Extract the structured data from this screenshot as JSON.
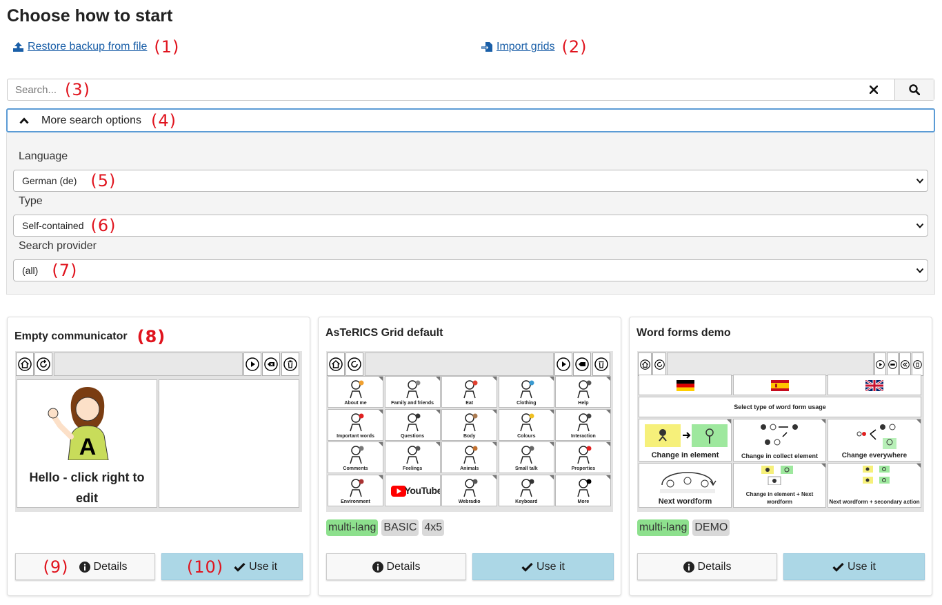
{
  "page": {
    "title": "Choose how to start"
  },
  "actions": {
    "restore_label": "Restore backup from file",
    "restore_marker": "(1)",
    "import_label": "Import grids",
    "import_marker": "(2)"
  },
  "search": {
    "placeholder": "Search...",
    "marker": "(3)"
  },
  "more_options": {
    "label": "More search options",
    "marker": "(4)"
  },
  "filters": {
    "language": {
      "label": "Language",
      "value": "German (de)",
      "marker": "(5)"
    },
    "type": {
      "label": "Type",
      "value": "Self-contained",
      "marker": "(6)"
    },
    "provider": {
      "label": "Search provider",
      "value": "(all)",
      "marker": "(7)"
    }
  },
  "cards": [
    {
      "title": "Empty communicator",
      "title_marker": "(8)",
      "preview_text": "Hello - click right to edit",
      "tags": [],
      "details_label": "Details",
      "details_marker": "(9)",
      "use_label": "Use it",
      "use_marker": "(10)"
    },
    {
      "title": "AsTeRICS Grid default",
      "cells": [
        "About me",
        "Family and friends",
        "Eat",
        "Clothing",
        "Help",
        "Important words",
        "Questions",
        "Body",
        "Colours",
        "Interaction",
        "Comments",
        "Feelings",
        "Animals",
        "Small talk",
        "Properties",
        "Environment",
        "YouTube",
        "Webradio",
        "Keyboard",
        "More"
      ],
      "tags": [
        "multi-lang",
        "BASIC",
        "4x5"
      ],
      "details_label": "Details",
      "use_label": "Use it"
    },
    {
      "title": "Word forms demo",
      "cells": [
        "Select type of word form usage",
        "Change in element",
        "Change in collect element",
        "Change everywhere",
        "Next wordform",
        "Change in element + Next wordform",
        "Next wordform + secondary action"
      ],
      "tags": [
        "multi-lang",
        "DEMO"
      ],
      "details_label": "Details",
      "use_label": "Use it"
    }
  ],
  "icons": {
    "upload": "upload-icon",
    "import": "import-icon",
    "clear": "times-icon",
    "search": "search-icon",
    "chevron": "chevron-up-icon",
    "info": "info-circle-icon",
    "check": "check-icon"
  },
  "colors": {
    "marker": "#e0141e",
    "link": "#1a5fa8",
    "use_button": "#acd7e6",
    "tag_green": "#8de08d",
    "tag_gray": "#d9d9d9",
    "focus_border": "#5b9bd5"
  }
}
